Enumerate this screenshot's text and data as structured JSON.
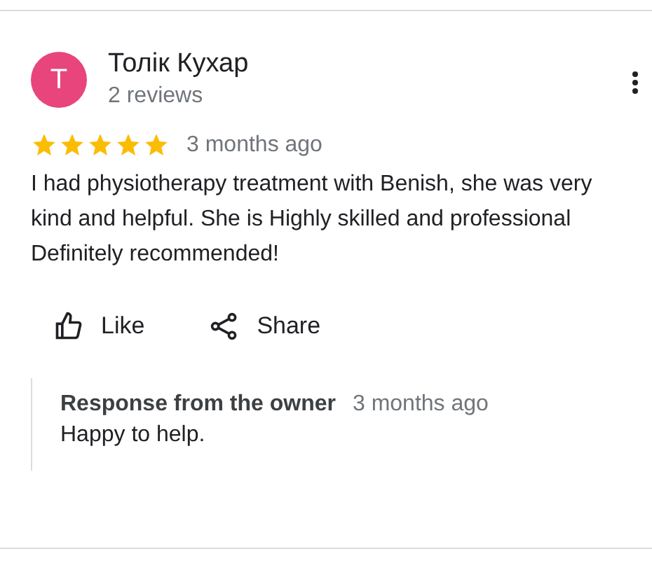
{
  "review": {
    "avatar_letter": "T",
    "author": "Толік Кухар",
    "author_meta": "2 reviews",
    "stars": 5,
    "date": "3 months ago",
    "text": "I had physiotherapy treatment with Benish, she was very kind and helpful. She is Highly skilled and professional Definitely recommended!",
    "actions": [
      {
        "kind": "like",
        "label": "Like"
      },
      {
        "kind": "share",
        "label": "Share"
      }
    ],
    "owner_response": {
      "title": "Response from the owner",
      "date": "3 months ago",
      "text": "Happy to help."
    }
  }
}
